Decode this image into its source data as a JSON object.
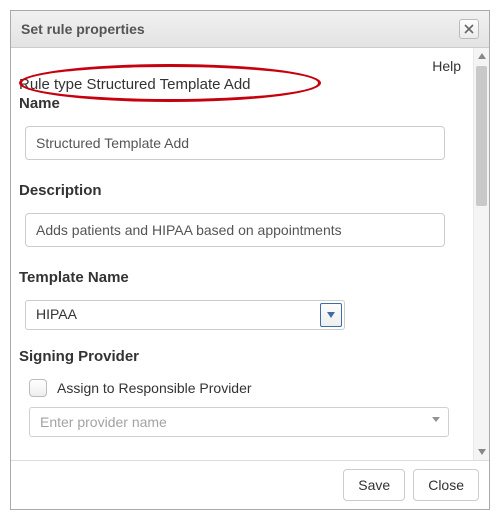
{
  "dialog": {
    "title": "Set rule properties",
    "help_label": "Help"
  },
  "rule_type_line": "Rule type Structured Template Add",
  "fields": {
    "name_label": "Name",
    "name_value": "Structured Template Add",
    "description_label": "Description",
    "description_value": "Adds patients and HIPAA based on appointments",
    "template_label": "Template Name",
    "template_value": "HIPAA",
    "signing_label": "Signing Provider",
    "assign_checkbox_label": "Assign to Responsible Provider",
    "provider_placeholder": "Enter provider name"
  },
  "footer": {
    "save_label": "Save",
    "close_label": "Close"
  }
}
